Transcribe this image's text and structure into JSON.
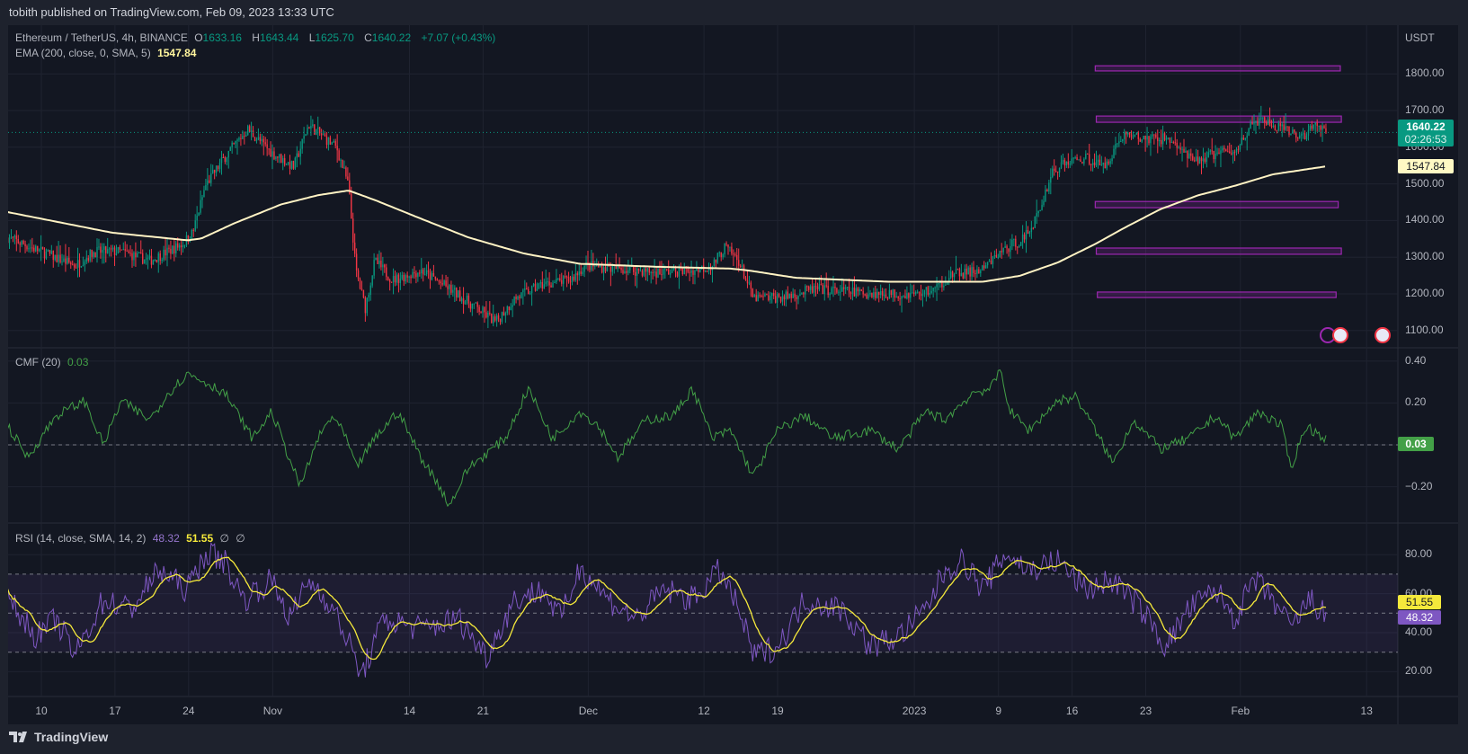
{
  "header": {
    "published": "tobith published on TradingView.com, Feb 09, 2023 13:33 UTC"
  },
  "legend": {
    "symbol": "Ethereum / TetherUS, 4h, BINANCE",
    "o_label": "O",
    "o": "1633.16",
    "h_label": "H",
    "h": "1643.44",
    "l_label": "L",
    "l": "1625.70",
    "c_label": "C",
    "c": "1640.22",
    "change": "+7.07 (+0.43%)",
    "ema_label": "EMA (200, close, 0, SMA, 5)",
    "ema_value": "1547.84",
    "cmf_label": "CMF (20)",
    "cmf_value": "0.03",
    "rsi_label": "RSI (14, close, SMA, 14, 2)",
    "rsi_value": "48.32",
    "rsi_ma_value": "51.55",
    "rsi_extra1": "∅",
    "rsi_extra2": "∅"
  },
  "price_axis": {
    "currency": "USDT",
    "labels": [
      "1800.00",
      "1700.00",
      "1600.00",
      "1500.00",
      "1400.00",
      "1300.00",
      "1200.00",
      "1100.00"
    ],
    "last_price": "1640.22",
    "countdown": "02:26:53",
    "ema_tag": "1547.84"
  },
  "cmf_axis": {
    "labels": [
      "0.40",
      "0.20",
      "0.00",
      "−0.20"
    ],
    "tag": "0.03"
  },
  "rsi_axis": {
    "labels": [
      "80.00",
      "60.00",
      "40.00",
      "20.00"
    ],
    "tag_ma": "51.55",
    "tag_rsi": "48.32"
  },
  "time_axis": [
    {
      "label": "10",
      "day": 0
    },
    {
      "label": "17",
      "day": 7
    },
    {
      "label": "24",
      "day": 14
    },
    {
      "label": "Nov",
      "day": 22
    },
    {
      "label": "14",
      "day": 35
    },
    {
      "label": "21",
      "day": 42
    },
    {
      "label": "Dec",
      "day": 52
    },
    {
      "label": "12",
      "day": 63
    },
    {
      "label": "19",
      "day": 70
    },
    {
      "label": "2023",
      "day": 83
    },
    {
      "label": "9",
      "day": 91
    },
    {
      "label": "16",
      "day": 98
    },
    {
      "label": "23",
      "day": 105
    },
    {
      "label": "Feb",
      "day": 114
    },
    {
      "label": "13",
      "day": 126
    }
  ],
  "footer": {
    "brand": "TradingView"
  },
  "colors": {
    "up": "#089981",
    "down": "#f23645",
    "ema": "#fff3c4",
    "cmf": "#43a047",
    "rsi": "#7e57c2",
    "rsi_ma": "#f5e93b",
    "zone": "#9c27b0"
  },
  "chart_data": {
    "type": "candlestick",
    "title": "Ethereum / TetherUS, 4h, BINANCE",
    "x_unit": "days since Oct 10 2022",
    "ylim": [
      1070,
      1860
    ],
    "price_close": [
      [
        -3.2,
        1354
      ],
      [
        -0.4,
        1320
      ],
      [
        3.2,
        1277
      ],
      [
        5,
        1315
      ],
      [
        7.6,
        1315
      ],
      [
        10.3,
        1290
      ],
      [
        13.4,
        1336
      ],
      [
        14.4,
        1367
      ],
      [
        15.6,
        1495
      ],
      [
        17.4,
        1572
      ],
      [
        19.6,
        1649
      ],
      [
        21.9,
        1585
      ],
      [
        24,
        1546
      ],
      [
        25.4,
        1662
      ],
      [
        28.1,
        1597
      ],
      [
        29.2,
        1495
      ],
      [
        29.9,
        1264
      ],
      [
        30.8,
        1162
      ],
      [
        31.7,
        1290
      ],
      [
        33.4,
        1238
      ],
      [
        36.1,
        1264
      ],
      [
        38.8,
        1213
      ],
      [
        41.4,
        1162
      ],
      [
        43.2,
        1123
      ],
      [
        45,
        1187
      ],
      [
        47.7,
        1226
      ],
      [
        50.3,
        1238
      ],
      [
        51.7,
        1277
      ],
      [
        54.8,
        1269
      ],
      [
        58.4,
        1259
      ],
      [
        62,
        1264
      ],
      [
        63.8,
        1277
      ],
      [
        65,
        1328
      ],
      [
        66.3,
        1290
      ],
      [
        67.7,
        1187
      ],
      [
        70.8,
        1192
      ],
      [
        73.5,
        1213
      ],
      [
        76.1,
        1208
      ],
      [
        79.6,
        1200
      ],
      [
        83.3,
        1200
      ],
      [
        85,
        1213
      ],
      [
        86.4,
        1251
      ],
      [
        89.5,
        1264
      ],
      [
        91.2,
        1315
      ],
      [
        93.5,
        1354
      ],
      [
        94.8,
        1418
      ],
      [
        96.1,
        1533
      ],
      [
        97.5,
        1559
      ],
      [
        99.3,
        1572
      ],
      [
        101,
        1546
      ],
      [
        102.9,
        1636
      ],
      [
        104.6,
        1623
      ],
      [
        107.3,
        1623
      ],
      [
        109.5,
        1559
      ],
      [
        111.7,
        1585
      ],
      [
        113.5,
        1585
      ],
      [
        114.4,
        1636
      ],
      [
        115.7,
        1674
      ],
      [
        117.9,
        1649
      ],
      [
        119.7,
        1628
      ],
      [
        121.5,
        1662
      ],
      [
        122.2,
        1640
      ]
    ],
    "ema200": [
      [
        -3.2,
        1423
      ],
      [
        1.4,
        1397
      ],
      [
        6.7,
        1367
      ],
      [
        13.9,
        1346
      ],
      [
        15.2,
        1351
      ],
      [
        18.3,
        1392
      ],
      [
        22.8,
        1444
      ],
      [
        26.3,
        1469
      ],
      [
        29.2,
        1482
      ],
      [
        31.7,
        1456
      ],
      [
        36.1,
        1405
      ],
      [
        40.6,
        1354
      ],
      [
        45.9,
        1310
      ],
      [
        51.2,
        1282
      ],
      [
        58.4,
        1274
      ],
      [
        65.5,
        1269
      ],
      [
        67.2,
        1264
      ],
      [
        71.7,
        1244
      ],
      [
        80.6,
        1233
      ],
      [
        89.5,
        1233
      ],
      [
        93,
        1249
      ],
      [
        96.6,
        1285
      ],
      [
        100.2,
        1336
      ],
      [
        102.9,
        1379
      ],
      [
        106.4,
        1431
      ],
      [
        110,
        1469
      ],
      [
        113.5,
        1495
      ],
      [
        117.1,
        1526
      ],
      [
        122.2,
        1548
      ]
    ],
    "zones": [
      {
        "from": 100.2,
        "to": 123.5,
        "top": 1822,
        "bottom": 1808
      },
      {
        "from": 100.3,
        "to": 123.6,
        "top": 1685,
        "bottom": 1668
      },
      {
        "from": 100.2,
        "to": 123.3,
        "top": 1452,
        "bottom": 1435
      },
      {
        "from": 100.3,
        "to": 123.6,
        "top": 1325,
        "bottom": 1308
      },
      {
        "from": 100.4,
        "to": 123.1,
        "top": 1205,
        "bottom": 1190
      }
    ],
    "cmf": {
      "ylim": [
        -0.32,
        0.44
      ],
      "values": [
        [
          -3.2,
          0.09
        ],
        [
          -1.3,
          -0.06
        ],
        [
          1.4,
          0.14
        ],
        [
          4.1,
          0.21
        ],
        [
          5.9,
          0
        ],
        [
          7.6,
          0.21
        ],
        [
          10.3,
          0.12
        ],
        [
          12.1,
          0.25
        ],
        [
          13.9,
          0.34
        ],
        [
          15.6,
          0.3
        ],
        [
          17.4,
          0.25
        ],
        [
          20.1,
          0.03
        ],
        [
          21.9,
          0.16
        ],
        [
          24.6,
          -0.2
        ],
        [
          26.3,
          0.03
        ],
        [
          27.7,
          0.14
        ],
        [
          29,
          0.03
        ],
        [
          29.9,
          -0.11
        ],
        [
          31.7,
          0.03
        ],
        [
          33.9,
          0.16
        ],
        [
          36.1,
          -0.06
        ],
        [
          37.9,
          -0.2
        ],
        [
          38.8,
          -0.29
        ],
        [
          40.6,
          -0.11
        ],
        [
          44.1,
          0.03
        ],
        [
          46.3,
          0.27
        ],
        [
          48.6,
          0.03
        ],
        [
          51.2,
          0.16
        ],
        [
          53,
          0.09
        ],
        [
          54.8,
          -0.06
        ],
        [
          57.5,
          0.12
        ],
        [
          60.1,
          0.14
        ],
        [
          61.9,
          0.27
        ],
        [
          63.8,
          0.03
        ],
        [
          65.5,
          0.07
        ],
        [
          67.7,
          -0.15
        ],
        [
          70,
          0.07
        ],
        [
          72.6,
          0.14
        ],
        [
          75.3,
          0.03
        ],
        [
          78.8,
          0.07
        ],
        [
          81.5,
          -0.02
        ],
        [
          84.1,
          0.16
        ],
        [
          85.9,
          0.12
        ],
        [
          88.6,
          0.25
        ],
        [
          90.3,
          0.27
        ],
        [
          91.2,
          0.36
        ],
        [
          92.1,
          0.16
        ],
        [
          93.9,
          0.07
        ],
        [
          96.6,
          0.21
        ],
        [
          98.4,
          0.23
        ],
        [
          100.2,
          0.07
        ],
        [
          101.9,
          -0.09
        ],
        [
          103.8,
          0.12
        ],
        [
          106.4,
          -0.02
        ],
        [
          109.1,
          0.03
        ],
        [
          111.7,
          0.14
        ],
        [
          113.5,
          0.03
        ],
        [
          115.7,
          0.16
        ],
        [
          117.9,
          0.09
        ],
        [
          118.8,
          -0.11
        ],
        [
          120.2,
          0.09
        ],
        [
          121.5,
          0.05
        ],
        [
          122.2,
          0.03
        ]
      ]
    },
    "rsi": {
      "ylim": [
        10,
        90
      ],
      "bands": [
        30,
        50,
        70
      ],
      "values": [
        [
          -3.2,
          57
        ],
        [
          -0.4,
          38
        ],
        [
          1.4,
          47
        ],
        [
          3.2,
          28
        ],
        [
          5.9,
          57
        ],
        [
          8.5,
          52
        ],
        [
          11.2,
          72
        ],
        [
          13.9,
          62
        ],
        [
          15.6,
          81
        ],
        [
          17.4,
          77
        ],
        [
          19.2,
          57
        ],
        [
          21.9,
          67
        ],
        [
          23.7,
          47
        ],
        [
          25.4,
          67
        ],
        [
          27.2,
          57
        ],
        [
          29,
          38
        ],
        [
          30.4,
          18
        ],
        [
          32.6,
          47
        ],
        [
          36.1,
          42
        ],
        [
          39.7,
          47
        ],
        [
          42.3,
          28
        ],
        [
          45,
          57
        ],
        [
          47.7,
          62
        ],
        [
          49.4,
          47
        ],
        [
          51.2,
          74
        ],
        [
          53.9,
          57
        ],
        [
          56.5,
          47
        ],
        [
          59.2,
          62
        ],
        [
          61.9,
          57
        ],
        [
          64.5,
          72
        ],
        [
          66.3,
          52
        ],
        [
          67.7,
          28
        ],
        [
          70,
          33
        ],
        [
          72.6,
          57
        ],
        [
          76.1,
          52
        ],
        [
          78.8,
          33
        ],
        [
          81.5,
          38
        ],
        [
          84.1,
          52
        ],
        [
          85.9,
          72
        ],
        [
          87.7,
          77
        ],
        [
          89.5,
          62
        ],
        [
          91.7,
          81
        ],
        [
          93.9,
          72
        ],
        [
          96.6,
          77
        ],
        [
          99.3,
          62
        ],
        [
          101.9,
          67
        ],
        [
          104.6,
          52
        ],
        [
          106.9,
          33
        ],
        [
          109.1,
          52
        ],
        [
          111.7,
          62
        ],
        [
          113.5,
          47
        ],
        [
          115.3,
          67
        ],
        [
          117.1,
          57
        ],
        [
          118.8,
          42
        ],
        [
          120.6,
          57
        ],
        [
          122.2,
          48
        ]
      ]
    }
  }
}
